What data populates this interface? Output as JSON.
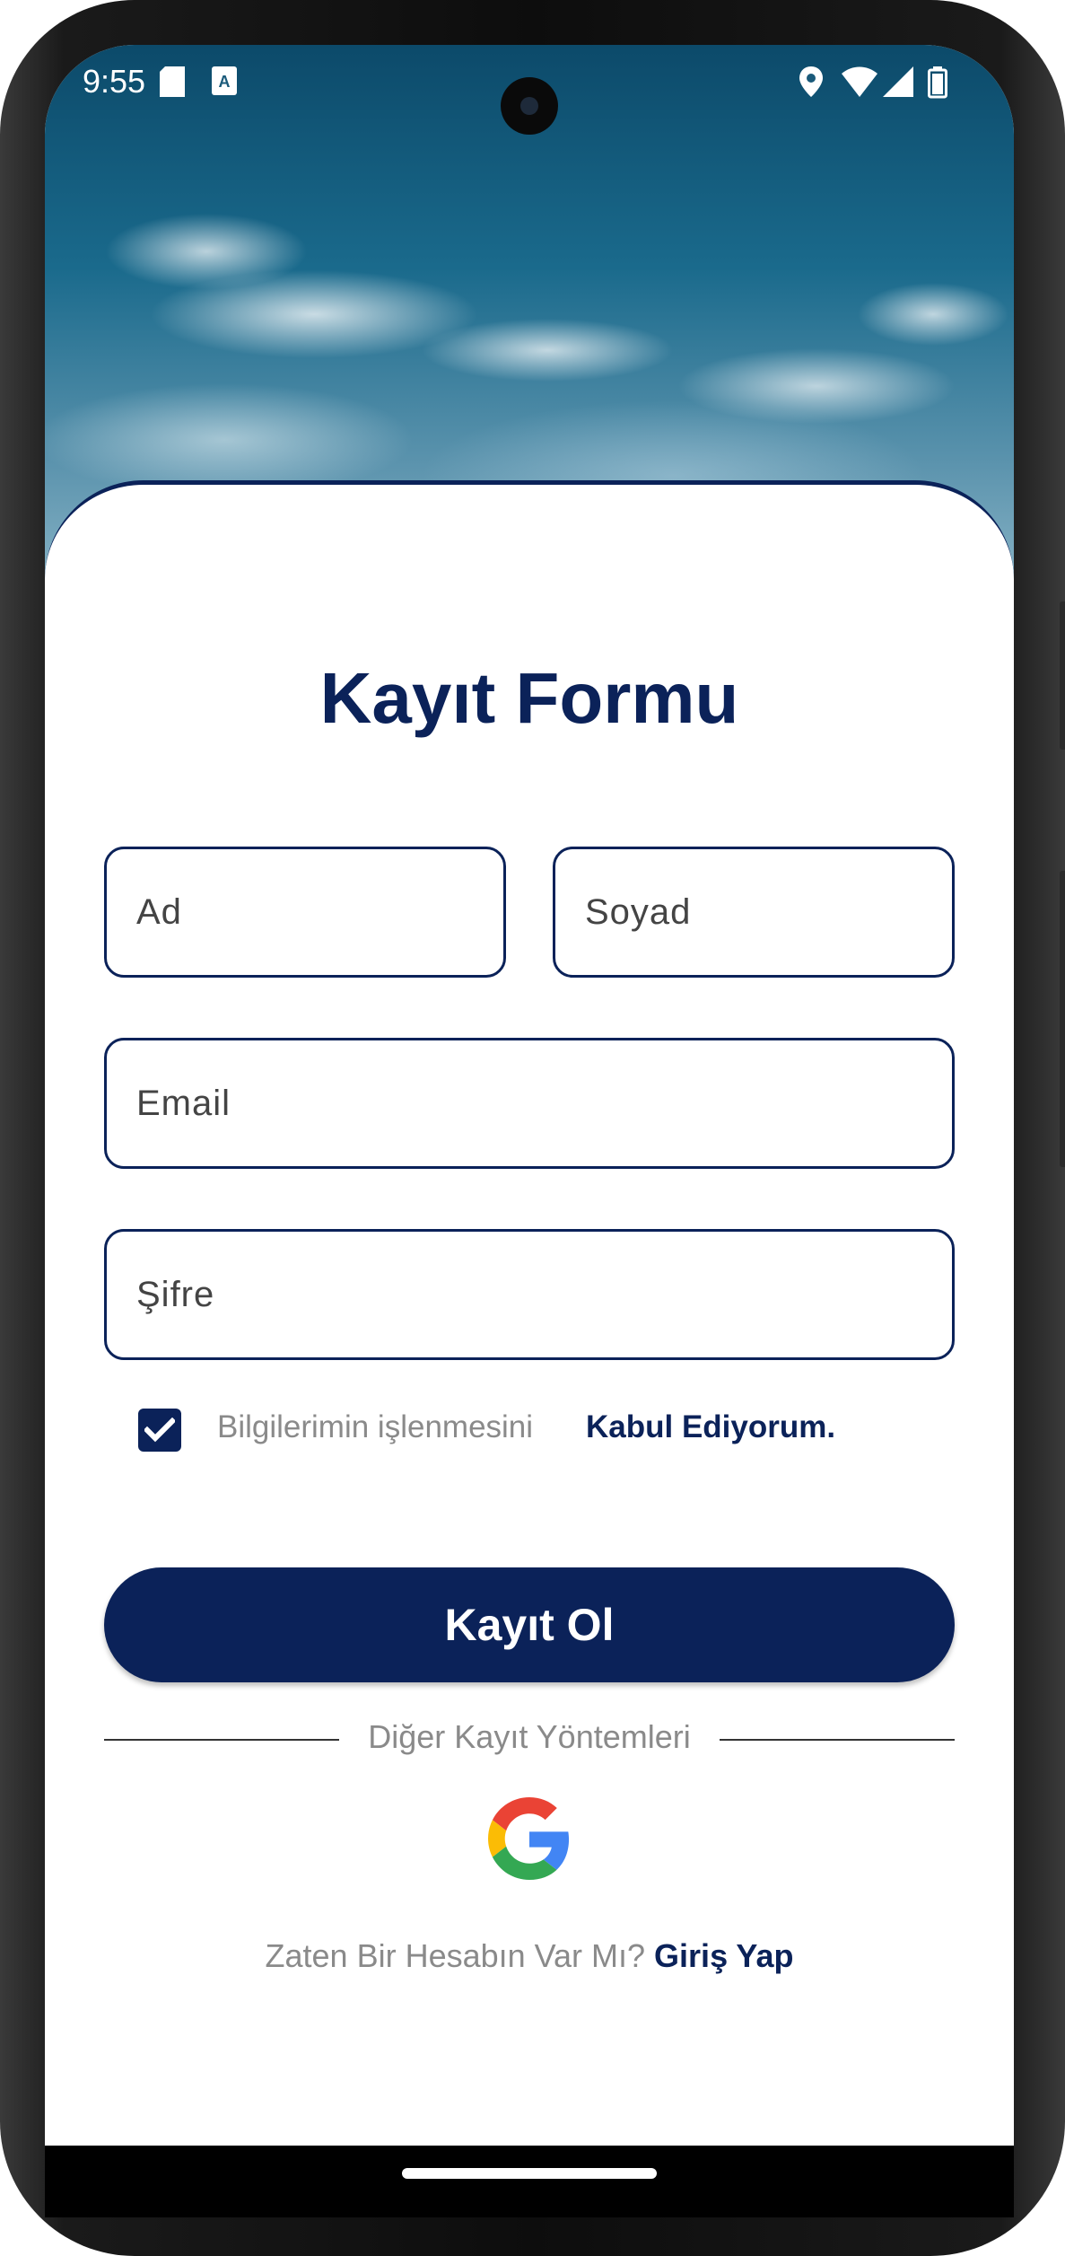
{
  "status_bar": {
    "time": "9:55",
    "icons": [
      "sd-card-icon",
      "keyboard-a-icon",
      "location-icon",
      "wifi-icon",
      "signal-icon",
      "battery-icon"
    ]
  },
  "form": {
    "title": "Kayıt Formu",
    "first_name_placeholder": "Ad",
    "last_name_placeholder": "Soyad",
    "email_placeholder": "Email",
    "password_placeholder": "Şifre",
    "consent_checked": true,
    "consent_text": "Bilgilerimin işlenmesini",
    "consent_accept": "Kabul Ediyorum.",
    "submit_label": "Kayıt Ol",
    "other_methods_label": "Diğer Kayıt Yöntemleri",
    "google_icon": "google-icon",
    "login_question": "Zaten Bir Hesabın Var Mı?",
    "login_link": "Giriş Yap"
  },
  "colors": {
    "primary": "#0b2259",
    "muted_text": "#8a8a8a",
    "background": "#ffffff"
  }
}
